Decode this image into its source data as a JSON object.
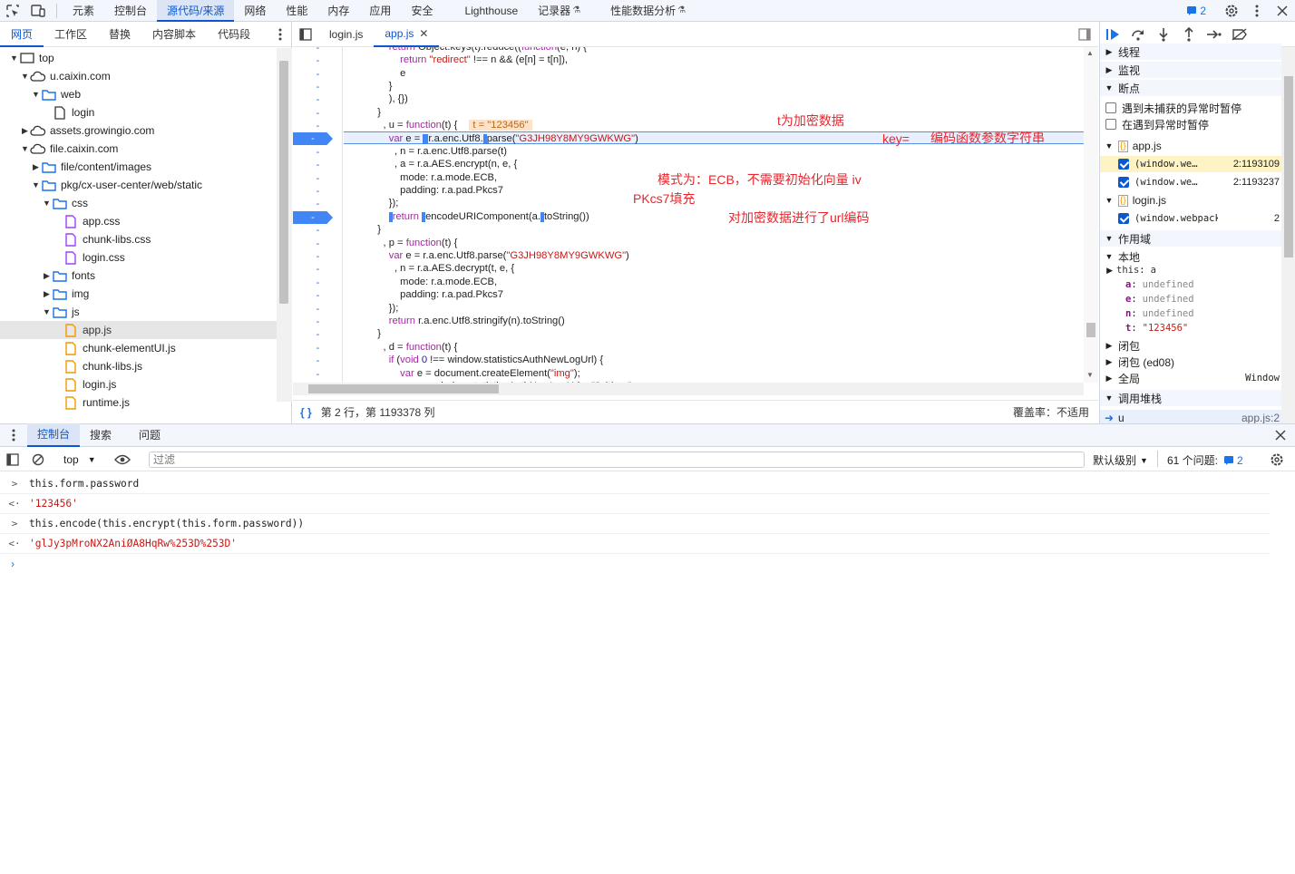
{
  "toolbar": {
    "tabs": [
      "元素",
      "控制台",
      "源代码/来源",
      "网络",
      "性能",
      "内存",
      "应用",
      "安全",
      "Lighthouse",
      "记录器",
      "性能数据分析"
    ],
    "active": "源代码/来源",
    "issues_badge": "2"
  },
  "navigator": {
    "tabs": [
      "网页",
      "工作区",
      "替换",
      "内容脚本",
      "代码段"
    ],
    "tree": [
      {
        "label": "top",
        "depth": 0,
        "icon": "frame",
        "arrow": "down"
      },
      {
        "label": "u.caixin.com",
        "depth": 1,
        "icon": "cloud",
        "arrow": "down"
      },
      {
        "label": "web",
        "depth": 2,
        "icon": "folder",
        "arrow": "down"
      },
      {
        "label": "login",
        "depth": 3,
        "icon": "file",
        "arrow": ""
      },
      {
        "label": "assets.growingio.com",
        "depth": 1,
        "icon": "cloud",
        "arrow": "right"
      },
      {
        "label": "file.caixin.com",
        "depth": 1,
        "icon": "cloud",
        "arrow": "down"
      },
      {
        "label": "file/content/images",
        "depth": 2,
        "icon": "folder",
        "arrow": "right"
      },
      {
        "label": "pkg/cx-user-center/web/static",
        "depth": 2,
        "icon": "folder",
        "arrow": "down"
      },
      {
        "label": "css",
        "depth": 3,
        "icon": "folder",
        "arrow": "down"
      },
      {
        "label": "app.css",
        "depth": 4,
        "icon": "css",
        "arrow": ""
      },
      {
        "label": "chunk-libs.css",
        "depth": 4,
        "icon": "css",
        "arrow": ""
      },
      {
        "label": "login.css",
        "depth": 4,
        "icon": "css",
        "arrow": ""
      },
      {
        "label": "fonts",
        "depth": 3,
        "icon": "folder",
        "arrow": "right"
      },
      {
        "label": "img",
        "depth": 3,
        "icon": "folder",
        "arrow": "right"
      },
      {
        "label": "js",
        "depth": 3,
        "icon": "folder",
        "arrow": "down"
      },
      {
        "label": "app.js",
        "depth": 4,
        "icon": "js",
        "arrow": "",
        "selected": true
      },
      {
        "label": "chunk-elementUI.js",
        "depth": 4,
        "icon": "js",
        "arrow": ""
      },
      {
        "label": "chunk-libs.js",
        "depth": 4,
        "icon": "js",
        "arrow": ""
      },
      {
        "label": "login.js",
        "depth": 4,
        "icon": "js",
        "arrow": ""
      },
      {
        "label": "runtime.js",
        "depth": 4,
        "icon": "js",
        "arrow": ""
      }
    ]
  },
  "editor": {
    "tabs": [
      "login.js",
      "app.js"
    ],
    "active": "app.js",
    "status": {
      "position": "第 2 行，第 1193378 列",
      "coverage": "覆盖率：不适用"
    },
    "annotations": {
      "t": "t为加密数据",
      "key": "key=",
      "key_desc": "编码函数参数字符串",
      "mode": "模式为：ECB，不需要初始化向量 iv",
      "pad": "PKcs7填充",
      "url": "对加密数据进行了url编码"
    },
    "inline_value": "t = \"123456\""
  },
  "debugger": {
    "threads": "线程",
    "watch": "监视",
    "breakpoints": "断点",
    "pause_uncaught": "遇到未捕获的异常时暂停",
    "pause_caught": "在遇到异常时暂停",
    "bp_files": [
      {
        "file": "app.js",
        "items": [
          {
            "text": "(window.we…",
            "loc": "2:1193109",
            "active": true
          },
          {
            "text": "(window.we…",
            "loc": "2:1193237"
          }
        ]
      },
      {
        "file": "login.js",
        "items": [
          {
            "text": "(window.webpackJ…",
            "loc": "2"
          }
        ]
      }
    ],
    "scope": "作用域",
    "local": "本地",
    "vars": [
      {
        "k": "this",
        "v": "a"
      },
      {
        "k": "a",
        "v": "undefined"
      },
      {
        "k": "e",
        "v": "undefined"
      },
      {
        "k": "n",
        "v": "undefined"
      },
      {
        "k": "t",
        "v": "\"123456\""
      }
    ],
    "closure1": "闭包",
    "closure2": "闭包 (ed08)",
    "global": "全局",
    "global_val": "Window",
    "callstack": "调用堆栈",
    "frame": "u",
    "frame_loc": "app.js:2"
  },
  "drawer": {
    "tabs": [
      "控制台",
      "搜索",
      "问题"
    ],
    "active": "控制台"
  },
  "console": {
    "context": "top",
    "filter_placeholder": "过滤",
    "level": "默认级别",
    "issues_label": "61 个问题:",
    "issues_count": "2",
    "lines": [
      {
        "type": "in",
        "text": "this.form.password"
      },
      {
        "type": "out",
        "text": "'123456'"
      },
      {
        "type": "in",
        "text": "this.encode(this.encrypt(this.form.password))"
      },
      {
        "type": "out",
        "text": "'glJy3pMroNX2AniØA8HqRw%253D%253D'"
      }
    ]
  }
}
